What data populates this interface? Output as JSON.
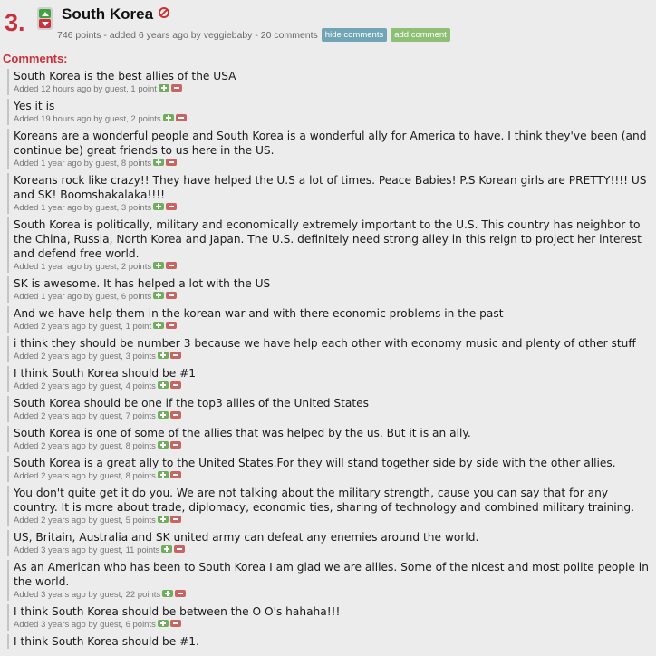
{
  "item": {
    "rank": "3.",
    "title": "South Korea",
    "points": "746 points",
    "added": "- added 6 years ago by veggiebaby -",
    "comments_count": "20 comments",
    "hide_comments_label": "hide comments",
    "add_comment_label": "add comment",
    "icons": [
      "vote-up-icon",
      "vote-down-icon",
      "ban-icon"
    ]
  },
  "comments_heading": "Comments:",
  "colors": {
    "rank": "#c8323c",
    "heading": "#c8323c",
    "hide_button": "#6fa5b5",
    "add_button": "#8dc075",
    "vote_up": "#3fa33f",
    "vote_down": "#c8323c"
  },
  "comments": [
    {
      "text": "South Korea is the best allies of the USA",
      "meta": "Added 12 hours ago by guest, 1 point"
    },
    {
      "text": "Yes it is",
      "meta": "Added 19 hours ago by guest, 2 points"
    },
    {
      "text": "Koreans are a wonderful people and South Korea is a wonderful ally for America to have. I think they've been (and continue be) great friends to us here in the US.",
      "meta": "Added 1 year ago by guest, 8 points"
    },
    {
      "text": "Koreans rock like crazy!! They have helped the U.S a lot of times. Peace Babies! P.S Korean girls are PRETTY!!!! US and SK! Boomshakalaka!!!!",
      "meta": "Added 1 year ago by guest, 3 points"
    },
    {
      "text": "South Korea is politically, military and economically extremely important to the U.S. This country has neighbor to the China, Russia, North Korea and Japan. The U.S. definitely need strong alley in this reign to project her interest and defend free world.",
      "meta": "Added 1 year ago by guest, 2 points"
    },
    {
      "text": "SK is awesome. It has helped a lot with the US",
      "meta": "Added 1 year ago by guest, 6 points"
    },
    {
      "text": "And we have help them in the korean war and with there economic problems in the past",
      "meta": "Added 2 years ago by guest, 1 point"
    },
    {
      "text": "i think they should be number 3 because we have help each other with economy music and plenty of other stuff",
      "meta": "Added 2 years ago by guest, 3 points"
    },
    {
      "text": "I think South Korea should be #1",
      "meta": "Added 2 years ago by guest, 4 points"
    },
    {
      "text": "South Korea should be one if the top3 allies of the United States",
      "meta": "Added 2 years ago by guest, 7 points"
    },
    {
      "text": "South Korea is one of some of the allies that was helped by the us. But it is an ally.",
      "meta": "Added 2 years ago by guest, 8 points"
    },
    {
      "text": "South Korea is a great ally to the United States.For they will stand together side by side with the other allies.",
      "meta": "Added 2 years ago by guest, 8 points"
    },
    {
      "text": "You don't quite get it do you. We are not talking about the military strength, cause you can say that for any country. It is more about trade, diplomacy, economic ties, sharing of technology and combined military training.",
      "meta": "Added 2 years ago by guest, 5 points"
    },
    {
      "text": "US, Britain, Australia and SK united army can defeat any enemies around the world.",
      "meta": "Added 3 years ago by guest, 11 points"
    },
    {
      "text": "As an American who has been to South Korea I am glad we are allies. Some of the nicest and most polite people in the world.",
      "meta": "Added 3 years ago by guest, 22 points"
    },
    {
      "text": "I think South Korea should be between the O O's hahaha!!!",
      "meta": "Added 3 years ago by guest, 6 points"
    },
    {
      "text": "I think South Korea should be #1.",
      "meta": ""
    }
  ]
}
